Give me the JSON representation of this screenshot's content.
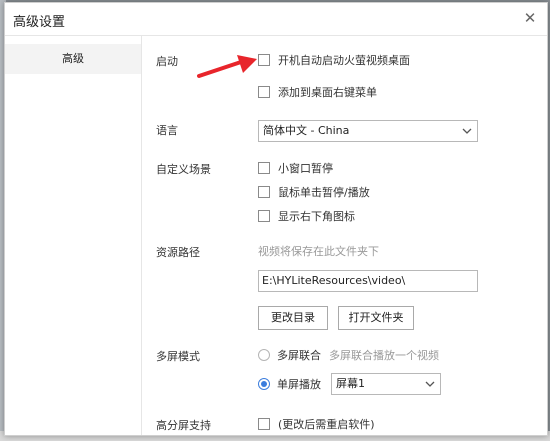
{
  "dialog": {
    "title": "高级设置"
  },
  "sidebar": {
    "items": [
      {
        "label": "高级"
      }
    ]
  },
  "startup": {
    "label": "启动",
    "options": [
      {
        "label": "开机自动启动火萤视频桌面",
        "checked": false
      },
      {
        "label": "添加到桌面右键菜单",
        "checked": false
      }
    ]
  },
  "language": {
    "label": "语言",
    "selected": "简体中文 - China"
  },
  "scene": {
    "label": "自定义场景",
    "options": [
      {
        "label": "小窗口暂停",
        "checked": false
      },
      {
        "label": "鼠标单击暂停/播放",
        "checked": false
      },
      {
        "label": "显示右下角图标",
        "checked": false
      }
    ]
  },
  "resource": {
    "label": "资源路径",
    "hint": "视频将保存在此文件夹下",
    "path": "E:\\HYLiteResources\\video\\",
    "change_dir_button": "更改目录",
    "open_folder_button": "打开文件夹"
  },
  "multiscreen": {
    "label": "多屏模式",
    "linked": {
      "label": "多屏联合",
      "desc": "多屏联合播放一个视频",
      "selected": false
    },
    "single": {
      "label": "单屏播放",
      "selected": true,
      "screen": "屏幕1"
    }
  },
  "hidpi": {
    "label": "高分屏支持",
    "note": "(更改后需重启软件)",
    "checked": false
  },
  "colors": {
    "accent": "#3b7ddd",
    "arrow": "#e8252b"
  }
}
